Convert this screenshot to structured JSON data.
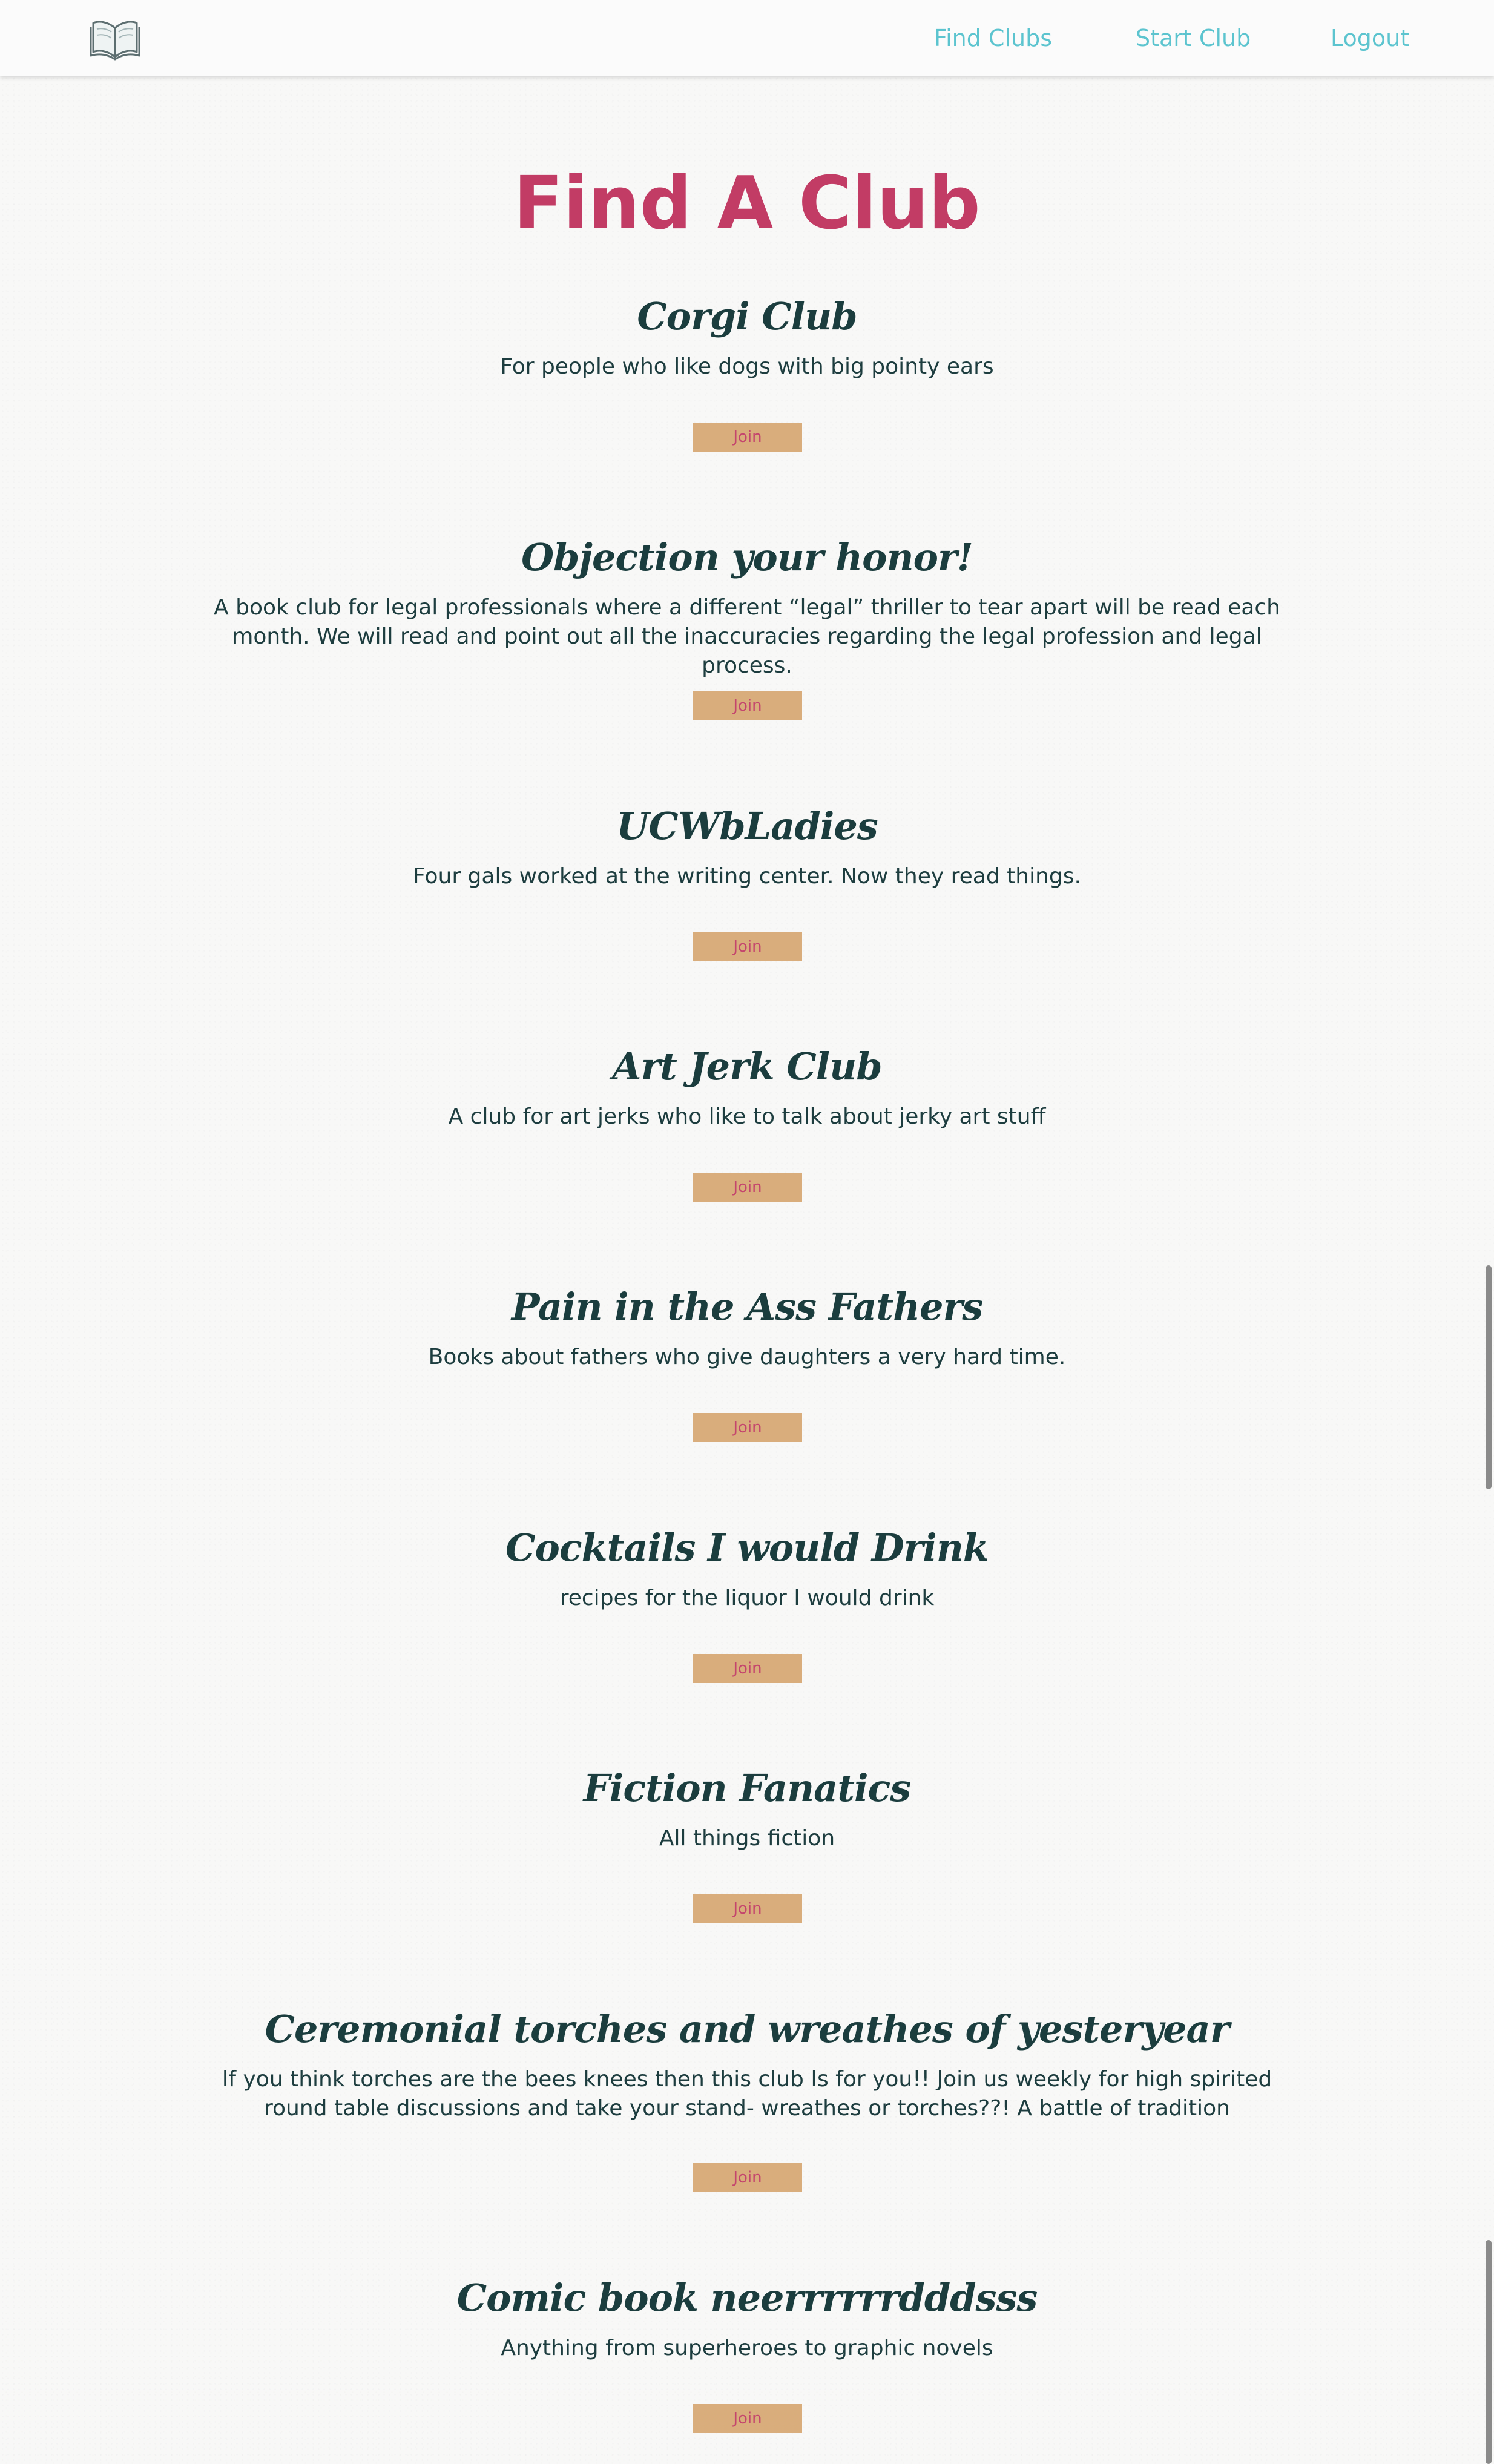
{
  "nav": {
    "logo_icon": "open-book-icon",
    "links": [
      "Find Clubs",
      "Start Club",
      "Logout"
    ]
  },
  "page": {
    "title": "Find A Club"
  },
  "clubs": [
    {
      "name": "Corgi Club",
      "description": "For people who like dogs with big pointy ears",
      "join_label": "Join"
    },
    {
      "name": "Objection your honor!",
      "description": "A book club for legal professionals where a different “legal” thriller to tear apart will be read each month. We will read and point out all the inaccuracies regarding the legal profession and legal process.",
      "join_label": "Join"
    },
    {
      "name": "UCWbLadies",
      "description": "Four gals worked at the writing center. Now they read things.",
      "join_label": "Join"
    },
    {
      "name": "Art Jerk Club",
      "description": "A club for art jerks who like to talk about jerky art stuff",
      "join_label": "Join"
    },
    {
      "name": "Pain in the Ass Fathers",
      "description": "Books about fathers who give daughters a very hard time.",
      "join_label": "Join"
    },
    {
      "name": "Cocktails I would Drink",
      "description": "recipes for the liquor I would drink",
      "join_label": "Join"
    },
    {
      "name": "Fiction Fanatics",
      "description": "All things fiction",
      "join_label": "Join"
    },
    {
      "name": "Ceremonial torches and wreathes of yesteryear",
      "description": "If you think torches are the bees knees then this club Is for you!! Join us weekly for high spirited round table discussions and take your stand- wreathes or torches??! A battle of tradition",
      "join_label": "Join"
    },
    {
      "name": "Comic book neerrrrrrdddsss",
      "description": "Anything from superheroes to graphic novels",
      "join_label": "Join"
    }
  ],
  "colors": {
    "nav_link": "#5cc4cf",
    "title": "#c23c65",
    "club_name": "#1b3d3e",
    "button_bg": "#d9ad7c",
    "button_text": "#c4456d"
  }
}
